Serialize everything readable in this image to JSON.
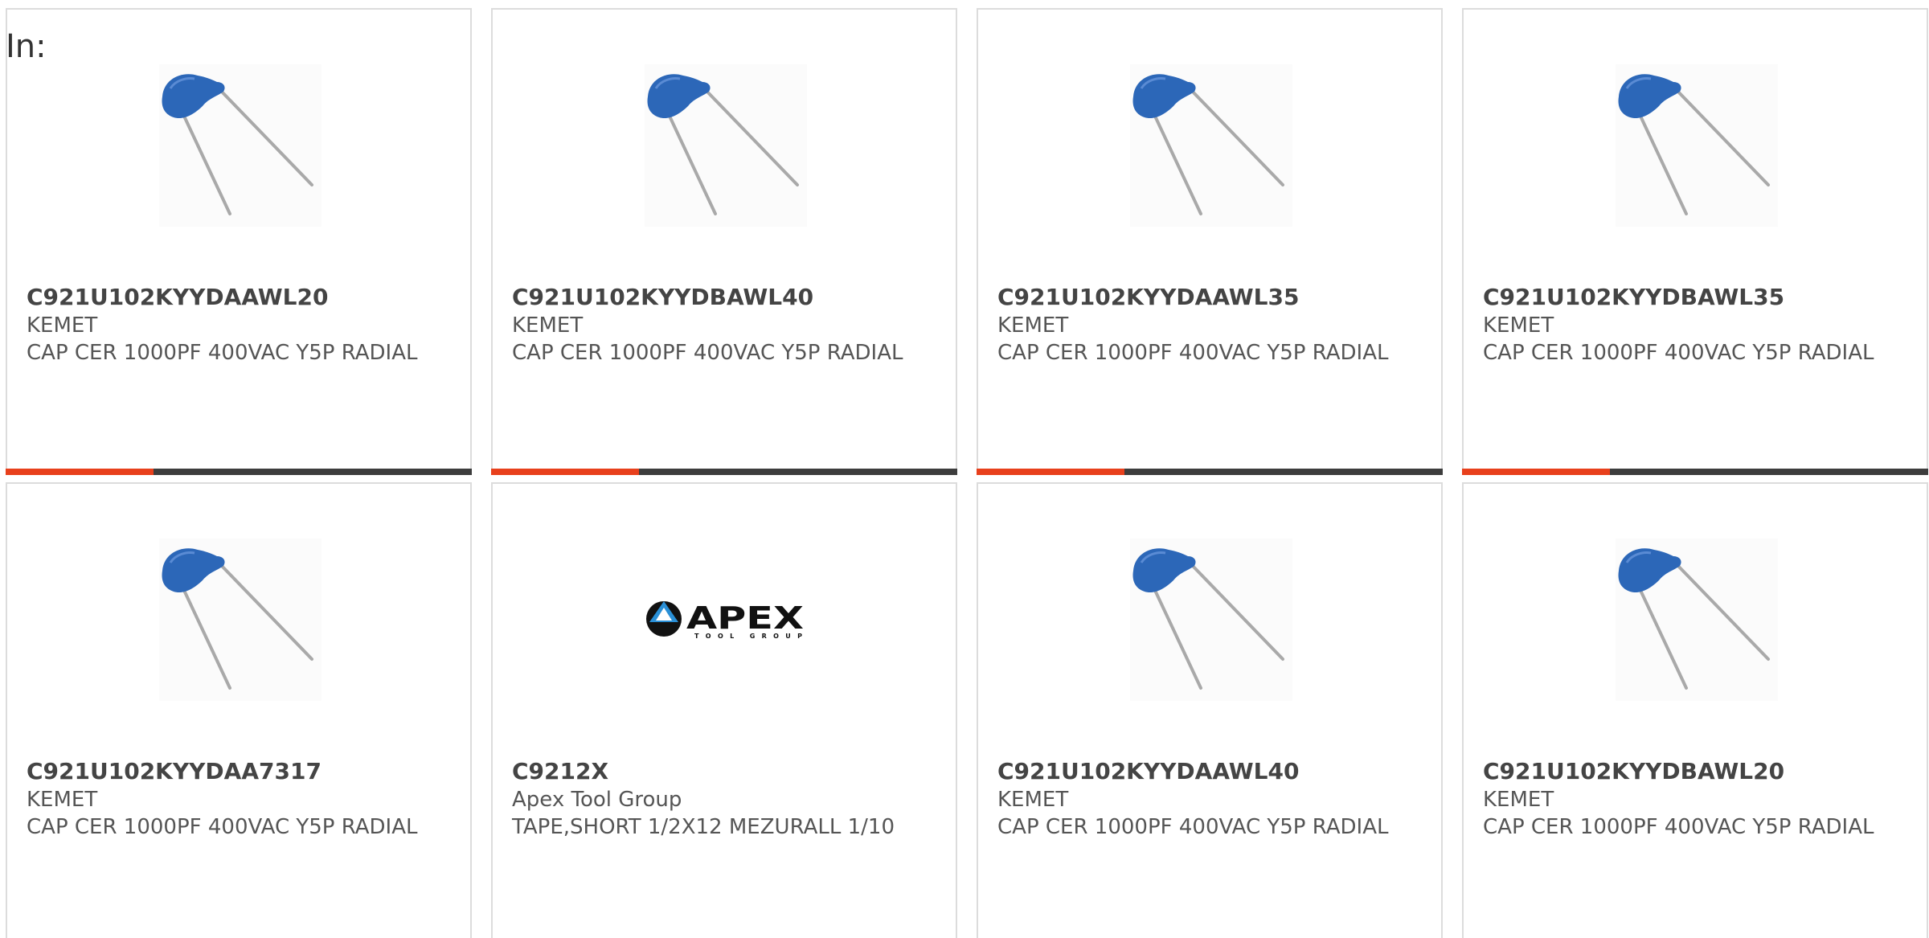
{
  "header": {
    "label": "In:"
  },
  "products": [
    {
      "part_number": "C921U102KYYDAAWL20",
      "manufacturer": "KEMET",
      "description": "CAP CER 1000PF 400VAC Y5P RADIAL",
      "image": "ceramic-capacitor-icon"
    },
    {
      "part_number": "C921U102KYYDBAWL40",
      "manufacturer": "KEMET",
      "description": "CAP CER 1000PF 400VAC Y5P RADIAL",
      "image": "ceramic-capacitor-icon"
    },
    {
      "part_number": "C921U102KYYDAAWL35",
      "manufacturer": "KEMET",
      "description": "CAP CER 1000PF 400VAC Y5P RADIAL",
      "image": "ceramic-capacitor-icon"
    },
    {
      "part_number": "C921U102KYYDBAWL35",
      "manufacturer": "KEMET",
      "description": "CAP CER 1000PF 400VAC Y5P RADIAL",
      "image": "ceramic-capacitor-icon"
    },
    {
      "part_number": "C921U102KYYDAA7317",
      "manufacturer": "KEMET",
      "description": "CAP CER 1000PF 400VAC Y5P RADIAL",
      "image": "ceramic-capacitor-icon"
    },
    {
      "part_number": "C9212X",
      "manufacturer": "Apex Tool Group",
      "description": "TAPE,SHORT 1/2X12 MEZURALL 1/10",
      "image": "apex-logo",
      "logo_text": "APEX",
      "logo_subtext": "TOOL GROUP"
    },
    {
      "part_number": "C921U102KYYDAAWL40",
      "manufacturer": "KEMET",
      "description": "CAP CER 1000PF 400VAC Y5P RADIAL",
      "image": "ceramic-capacitor-icon"
    },
    {
      "part_number": "C921U102KYYDBAWL20",
      "manufacturer": "KEMET",
      "description": "CAP CER 1000PF 400VAC Y5P RADIAL",
      "image": "ceramic-capacitor-icon"
    }
  ],
  "colors": {
    "accent": "#e8401c",
    "bar": "#3d3d3d",
    "capacitor_blue": "#2c67b8"
  }
}
